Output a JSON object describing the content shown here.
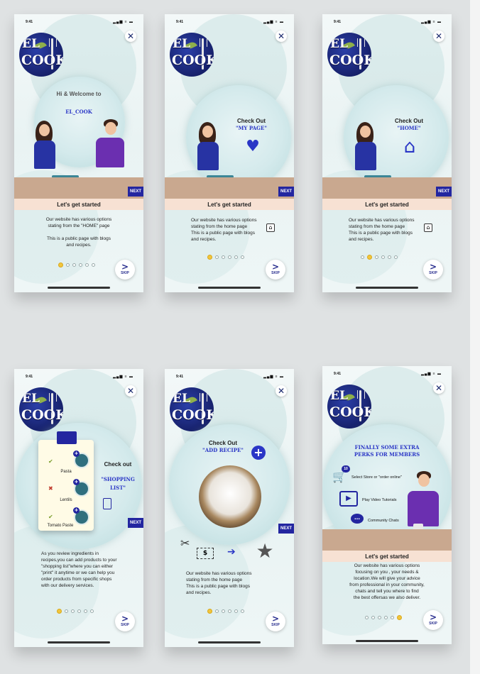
{
  "status_time": "9:41",
  "status_icons": "▂▄▆ ≡ ▬",
  "logo": {
    "line1": "EL",
    "line2": "COOK"
  },
  "close_symbol": "✕",
  "next_label": "NEXT",
  "skip": {
    "arrow": ">",
    "label": "SKIP"
  },
  "started_label": "Let's get started",
  "screens": {
    "s1": {
      "welcome": "Hi & Welcome to",
      "brand": "EL_COOK",
      "description": "Our website has various options\nstating from the \"HOME\" page\n\nThis is a public page with blogs\nand recipes."
    },
    "s2": {
      "checkout": "Check Out",
      "target": "\"MY PAGE\"",
      "description": "Our website has various options\nstating from the home page\nThis is a public page with blogs\nand recipes."
    },
    "s3": {
      "checkout": "Check Out",
      "target": "\"HOME\"",
      "description": "Our website has various options\nstating from the home page\nThis is a public page with blogs\nand recipes."
    },
    "s4": {
      "checkout": "Check out",
      "target": "\"SHOPPING\nLIST\"",
      "items": [
        "Pasta",
        "Lentils",
        "Tomato Paste"
      ],
      "description": "As you review ingredients in\nrecipes,you can add products to your\n\"shopping list\"where you can either\n\"print\" it anytime or we can help you\norder products from specific shops\nwith our delivery services."
    },
    "s5": {
      "checkout": "Check Out",
      "target": "\"ADD RECIPE\"",
      "price_symbol": "$",
      "description": "Our website has various options\nstating from the home page\nThis is a public page with blogs\nand recipes."
    },
    "s6": {
      "heading": "FINALLY SOME EXTRA\nPERKS FOR MEMBERS",
      "badge": "10",
      "perks": [
        "Select Store or \"order online\"",
        "Play Video Tutorials",
        "Community Chats"
      ],
      "description": "Our website has various options\nfocusing on you , your needs &\nlocation.We will give your advice\nfrom professional in your community,\nchats and tell you where to find\nthe best offersas we also deliver."
    }
  },
  "colors": {
    "accent": "#2326a0",
    "highlight": "#2a36c6",
    "dot_active": "#f2c53d",
    "counter": "#c9a88f"
  }
}
